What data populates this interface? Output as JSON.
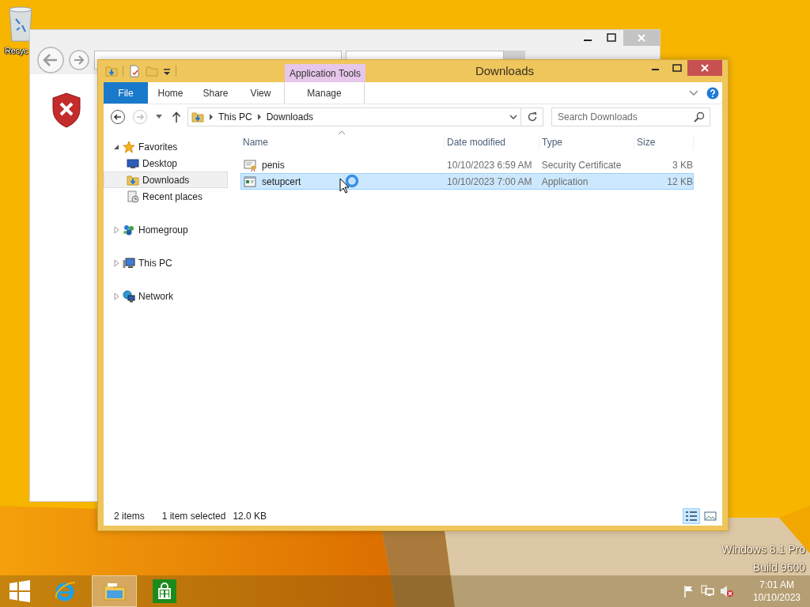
{
  "desktop": {
    "icons": [
      {
        "label": "Recyc"
      }
    ],
    "edition_text": [
      "Windows 8.1 Pro",
      "Build 9600"
    ]
  },
  "explorer": {
    "title": "Downloads",
    "context_group": "Application Tools",
    "ribbon_tabs": [
      {
        "label": "File",
        "kind": "file",
        "selected": false
      },
      {
        "label": "Home",
        "kind": "tab",
        "selected": false
      },
      {
        "label": "Share",
        "kind": "tab",
        "selected": false
      },
      {
        "label": "View",
        "kind": "tab",
        "selected": false
      },
      {
        "label": "Manage",
        "kind": "contextual",
        "selected": false
      }
    ],
    "breadcrumb": [
      "This PC",
      "Downloads"
    ],
    "search": {
      "placeholder": "Search Downloads"
    },
    "nav": [
      {
        "label": "Favorites",
        "kind": "favorites",
        "expanded": true,
        "selected": false,
        "children": [
          {
            "label": "Desktop",
            "kind": "desktop",
            "selected": false
          },
          {
            "label": "Downloads",
            "kind": "downloads",
            "selected": true
          },
          {
            "label": "Recent places",
            "kind": "recent",
            "selected": false
          }
        ]
      },
      {
        "label": "Homegroup",
        "kind": "homegroup",
        "expanded": false,
        "selected": false
      },
      {
        "label": "This PC",
        "kind": "pc",
        "expanded": false,
        "selected": false
      },
      {
        "label": "Network",
        "kind": "network",
        "expanded": false,
        "selected": false
      }
    ],
    "columns": [
      "Name",
      "Date modified",
      "Type",
      "Size"
    ],
    "files": [
      {
        "name": "penis",
        "kind": "certificate",
        "date": "10/10/2023 6:59 AM",
        "type": "Security Certificate",
        "size": "3 KB",
        "selected": false
      },
      {
        "name": "setupcert",
        "kind": "application",
        "date": "10/10/2023 7:00 AM",
        "type": "Application",
        "size": "12 KB",
        "selected": true
      }
    ],
    "status": {
      "items": "2 items",
      "selection": "1 item selected",
      "selection_size": "12.0 KB"
    },
    "views": [
      {
        "kind": "details",
        "selected": true
      },
      {
        "kind": "large-icons",
        "selected": false
      }
    ]
  },
  "taskbar": {
    "apps": [
      {
        "kind": "ie",
        "active": false
      },
      {
        "kind": "explorer",
        "active": true
      },
      {
        "kind": "store",
        "active": false
      }
    ],
    "time": "7:01 AM",
    "date": "10/10/2023"
  }
}
